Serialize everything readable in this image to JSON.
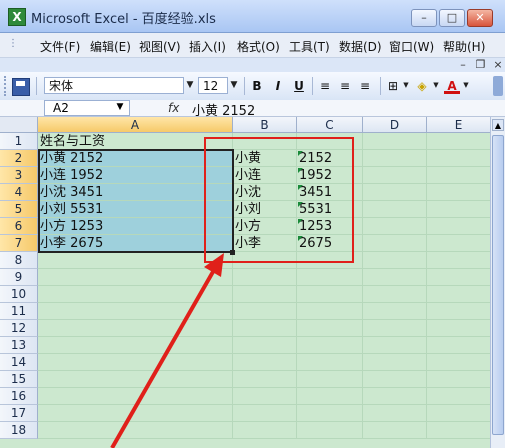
{
  "window": {
    "title": "Microsoft Excel - 百度经验.xls",
    "controls": {
      "minimize": "–",
      "maximize": "□",
      "close": "✕"
    },
    "app_icon": "X"
  },
  "menu": [
    "文件(F)",
    "编辑(E)",
    "视图(V)",
    "插入(I)",
    "格式(O)",
    "工具(T)",
    "数据(D)",
    "窗口(W)",
    "帮助(H)"
  ],
  "doc_controls": {
    "minimize": "–",
    "restore": "❐",
    "close": "×"
  },
  "toolbar": {
    "font_name": "宋体",
    "font_size": "12",
    "bold": "B",
    "italic": "I",
    "underline": "U",
    "font_color_label": "A",
    "icons": [
      "save-icon",
      "align-left-icon",
      "align-center-icon",
      "align-right-icon",
      "borders-icon",
      "fill-color-icon",
      "font-color-icon"
    ]
  },
  "formula_bar": {
    "name_box": "A2",
    "fx": "fx",
    "value": "小黄  2152"
  },
  "sheet": {
    "columns": [
      "A",
      "B",
      "C",
      "D",
      "E"
    ],
    "rows": [
      "1",
      "2",
      "3",
      "4",
      "5",
      "6",
      "7",
      "8",
      "9",
      "10",
      "11",
      "12",
      "13",
      "14",
      "15",
      "16",
      "17",
      "18"
    ],
    "header_A1": "姓名与工资",
    "col_a": [
      "小黄  2152",
      "小连  1952",
      "小沈  3451",
      "小刘  5531",
      "小方  1253",
      "小李  2675"
    ],
    "col_b": [
      "小黄",
      "小连",
      "小沈",
      "小刘",
      "小方",
      "小李"
    ],
    "col_c": [
      "2152",
      "1952",
      "3451",
      "5531",
      "1253",
      "2675"
    ],
    "selected_range": "A2:A7"
  },
  "colors": {
    "selection_fill": "#9ed0dc",
    "grid_bg": "#cce8cf",
    "annotation_red": "#e0201a"
  }
}
